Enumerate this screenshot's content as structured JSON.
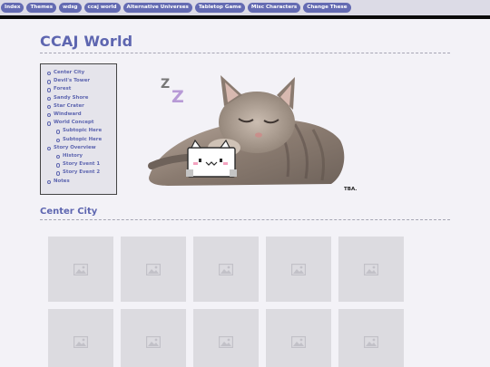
{
  "nav": {
    "items": [
      {
        "label": "Index"
      },
      {
        "label": "Themes"
      },
      {
        "label": "wdsg"
      },
      {
        "label": "ccaj world"
      },
      {
        "label": "Alternative Universes"
      },
      {
        "label": "Tabletop Game"
      },
      {
        "label": "Misc Characters"
      },
      {
        "label": "Change These"
      }
    ]
  },
  "page": {
    "title": "CCAJ World",
    "tba_text": "TBA."
  },
  "toc": {
    "items": [
      {
        "label": "Center City"
      },
      {
        "label": "Devil's Tower"
      },
      {
        "label": "Forest"
      },
      {
        "label": "Sandy Shore"
      },
      {
        "label": "Star Crater"
      },
      {
        "label": "Windward"
      },
      {
        "label": "World Concept"
      },
      {
        "label": "Subtopic Here"
      },
      {
        "label": "Subtopic Here"
      },
      {
        "label": "Story Overview"
      },
      {
        "label": "History"
      },
      {
        "label": "Story Event 1"
      },
      {
        "label": "Story Event 2"
      },
      {
        "label": "Notes"
      }
    ]
  },
  "section": {
    "title": "Center City"
  },
  "colors": {
    "accent": "#5e66b0",
    "nav_pill": "#646bb2",
    "nav_bar": "#dcdbe6",
    "background": "#f3f2f7",
    "thumb": "#dcdbe0"
  },
  "icons": {
    "thumb": "image-placeholder-icon",
    "art": "sleeping-kitten-with-pixel-cat"
  }
}
